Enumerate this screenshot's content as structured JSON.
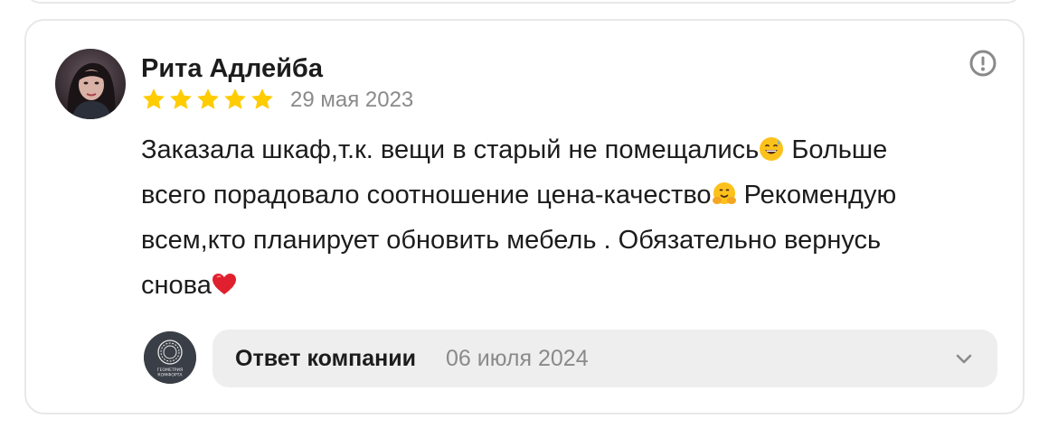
{
  "review": {
    "author_name": "Рита Адлейба",
    "rating": 5,
    "rating_max": 5,
    "date": "29 мая 2023",
    "text_lines": [
      "Заказала шкаф,т.к. вещи в старый не помещались",
      " Больше",
      "всего порадовало соотношение цена-качество",
      " Рекомендую",
      "всем,кто планирует обновить мебель . Обязательно вернусь",
      "снова"
    ],
    "emojis": [
      "grinning-sweat-emoji",
      "hugging-face-emoji",
      "red-heart-emoji"
    ]
  },
  "company_reply": {
    "label": "Ответ компании",
    "date": "06 июля 2024",
    "logo_text_line1": "ГЕОМЕТРИЯ",
    "logo_text_line2": "КОМФОРТА"
  },
  "colors": {
    "star": "#ffcc00",
    "muted_text": "#8a8a8a",
    "reply_bg": "#eeeeee",
    "logo_bg": "#3a3f47"
  },
  "icons": {
    "more": "exclamation-circle-icon",
    "expand": "chevron-down-icon"
  }
}
